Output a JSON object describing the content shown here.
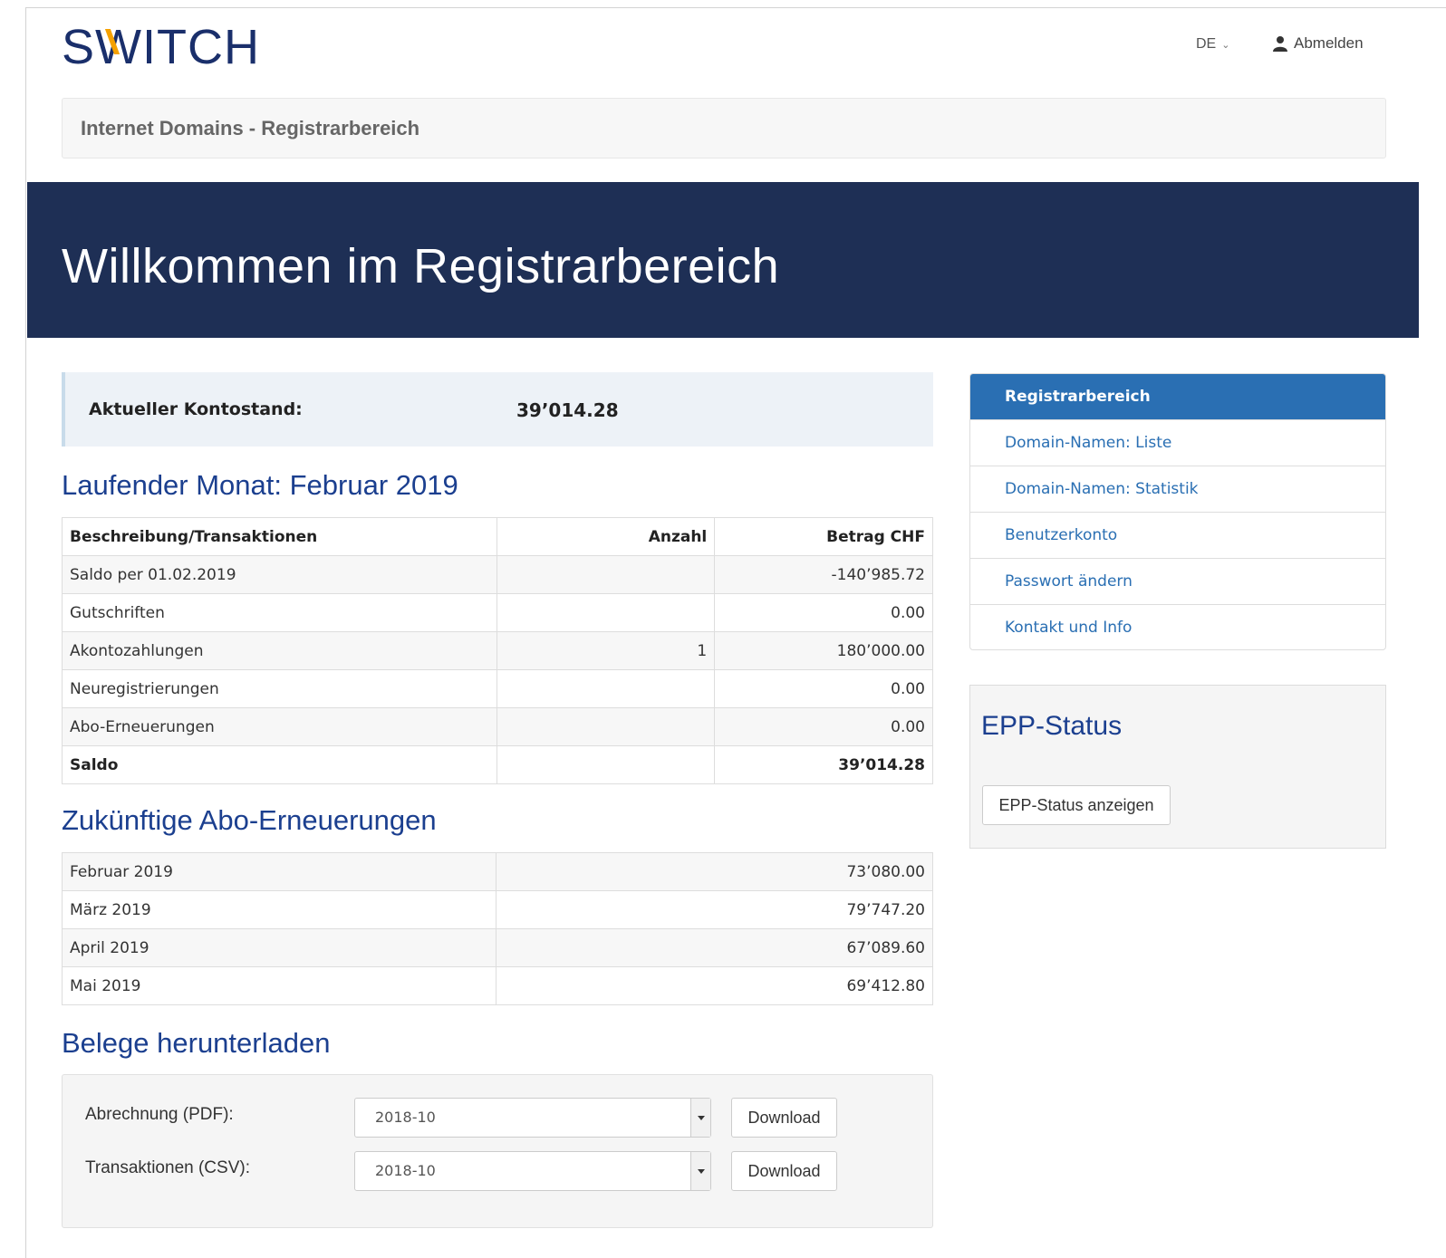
{
  "header": {
    "logo_text": "SWITCH",
    "language": "DE",
    "language_icon": "chevron-down-icon",
    "logout_label": "Abmelden",
    "logout_icon": "user-icon"
  },
  "subnav": {
    "title": "Internet Domains - Registrarbereich"
  },
  "hero": {
    "title": "Willkommen im Registrarbereich"
  },
  "balance": {
    "label": "Aktueller Kontostand:",
    "value": "39’014.28"
  },
  "current_month": {
    "heading": "Laufender Monat: Februar 2019",
    "columns": [
      "Beschreibung/Transaktionen",
      "Anzahl",
      "Betrag CHF"
    ],
    "rows": [
      {
        "desc": "Saldo per 01.02.2019",
        "count": "",
        "amount": "-140’985.72"
      },
      {
        "desc": "Gutschriften",
        "count": "",
        "amount": "0.00"
      },
      {
        "desc": "Akontozahlungen",
        "count": "1",
        "amount": "180’000.00"
      },
      {
        "desc": "Neuregistrierungen",
        "count": "",
        "amount": "0.00"
      },
      {
        "desc": "Abo-Erneuerungen",
        "count": "",
        "amount": "0.00"
      },
      {
        "desc": "Saldo",
        "count": "",
        "amount": "39’014.28"
      }
    ]
  },
  "future_renewals": {
    "heading": "Zukünftige Abo-Erneuerungen",
    "rows": [
      {
        "month": "Februar 2019",
        "amount": "73’080.00"
      },
      {
        "month": "März 2019",
        "amount": "79’747.20"
      },
      {
        "month": "April 2019",
        "amount": "67’089.60"
      },
      {
        "month": "Mai 2019",
        "amount": "69’412.80"
      }
    ]
  },
  "downloads": {
    "heading": "Belege herunterladen",
    "rows": [
      {
        "label": "Abrechnung (PDF):",
        "selected": "2018-10",
        "button": "Download"
      },
      {
        "label": "Transaktionen (CSV):",
        "selected": "2018-10",
        "button": "Download"
      }
    ]
  },
  "sidebar": {
    "items": [
      {
        "label": "Registrarbereich",
        "active": true
      },
      {
        "label": "Domain-Namen: Liste"
      },
      {
        "label": "Domain-Namen: Statistik"
      },
      {
        "label": "Benutzerkonto"
      },
      {
        "label": "Passwort ändern"
      },
      {
        "label": "Kontakt und Info"
      }
    ]
  },
  "epp": {
    "heading": "EPP-Status",
    "button": "EPP-Status anzeigen"
  },
  "colors": {
    "brand_navy": "#1e2f55",
    "accent_blue": "#2a6fb3",
    "heading_blue": "#1b3f8f",
    "logo_accent": "#f5a100"
  }
}
